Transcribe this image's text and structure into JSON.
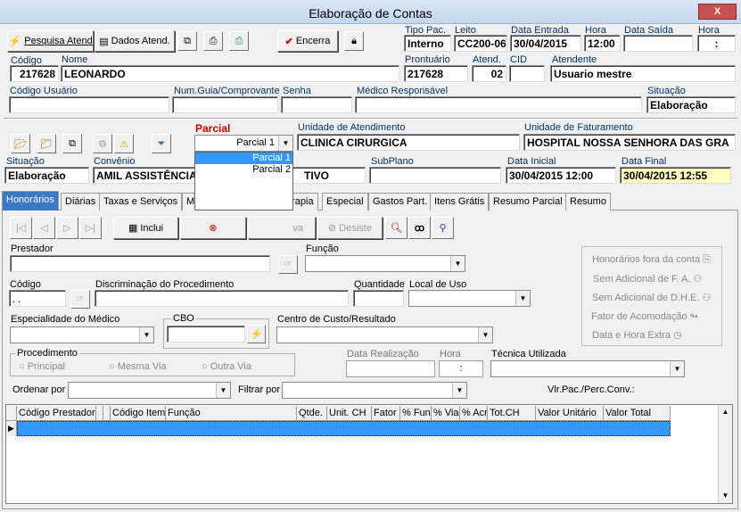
{
  "window": {
    "title": "Elaboração de Contas",
    "close_label": "X"
  },
  "toolbar": {
    "pesquisa_atend": "Pesquisa Atend",
    "dados_atend": "Dados Atend.",
    "encerra": "Encerra"
  },
  "header": {
    "tipo_pac_label": "Tipo Pac.",
    "tipo_pac": "Interno",
    "leito_label": "Leito",
    "leito": "CC200-06",
    "data_entrada_label": "Data Entrada",
    "data_entrada": "30/04/2015",
    "hora_label": "Hora",
    "hora": "12:00",
    "data_saida_label": "Data Saída",
    "data_saida": "",
    "hora2_label": "Hora",
    "hora2": ":",
    "codigo_label": "Código",
    "codigo": "217628",
    "nome_label": "Nome",
    "nome": "LEONARDO",
    "prontuario_label": "Prontuário",
    "prontuario": "217628",
    "atend_label": "Atend.",
    "atend": "02",
    "cid_label": "CID",
    "cid": "",
    "atendente_label": "Atendente",
    "atendente": "Usuario mestre",
    "codigo_usuario_label": "Código Usuário",
    "num_guia_label": "Num.Guia/Comprovante",
    "senha_label": "Senha",
    "medico_label": "Médico Responsável",
    "situacao_label": "Situação",
    "situacao": "Elaboração"
  },
  "parcial": {
    "label": "Parcial",
    "selected": "Parcial 1",
    "options": [
      "Parcial 1",
      "Parcial 2"
    ],
    "unidade_atend_label": "Unidade de Atendimento",
    "unidade_atend": "CLINICA CIRURGICA",
    "unidade_fat_label": "Unidade de Faturamento",
    "unidade_fat": "HOSPITAL NOSSA SENHORA DAS GRA",
    "situacao_label": "Situação",
    "situacao": "Elaboração",
    "convenio_label": "Convênio",
    "convenio": "AMIL ASSISTÊNCIA",
    "convenio_tail": "TIVO",
    "subplano_label": "SubPlano",
    "data_inicial_label": "Data Inicial",
    "data_inicial": "30/04/2015 12:00",
    "data_final_label": "Data Final",
    "data_final": "30/04/2015 12:55"
  },
  "tabs": [
    "Honorários",
    "Diárias",
    "Taxas e Serviços",
    "M",
    "erapia",
    "Especial",
    "Gastos Part.",
    "Itens Grátis",
    "Resumo Parcial",
    "Resumo"
  ],
  "honorarios": {
    "inclui": "Inclui",
    "salva": "va",
    "desiste": "Desiste",
    "prestador_label": "Prestador",
    "funcao_label": "Função",
    "codigo_label": "Código",
    "codigo_value": ". .",
    "discriminacao_label": "Discriminação do Procedimento",
    "quantidade_label": "Quantidade",
    "local_uso_label": "Local de Uso",
    "especialidade_label": "Especialidade do Médico",
    "cbo_label": "CBO",
    "centro_custo_label": "Centro de Custo/Resultado",
    "procedimento_label": "Procedimento",
    "radios": [
      "Principal",
      "Mesma Via",
      "Outra Via"
    ],
    "data_realizacao_label": "Data Realização",
    "hora_label": "Hora",
    "hora_value": ":",
    "tecnica_label": "Técnica Utilizada",
    "ordenar_label": "Ordenar por",
    "filtrar_label": "Filtrar por",
    "vlr_label": "Vlr.Pac./Perc.Conv.:",
    "right_panel": [
      "Honorários fora da conta",
      "Sem Adicional de F. A.",
      "Sem Adicional de D.H.E.",
      "Fator de Acomodação",
      "Data e Hora Extra"
    ]
  },
  "grid": {
    "columns": [
      "Código Prestador",
      "Código Item",
      "Função",
      "Qtde.",
      "Unit. CH",
      "Fator",
      "% Fun",
      "% Via",
      "% Acr",
      "Tot.CH",
      "Valor Unitário",
      "Valor Total"
    ]
  },
  "colors": {
    "title_bg": "#dbe7f5",
    "tab_active": "#3a79c8",
    "row_selected": "#3399ff",
    "data_final_bg": "#ffffc0",
    "parcial_label": "#cc0000"
  }
}
